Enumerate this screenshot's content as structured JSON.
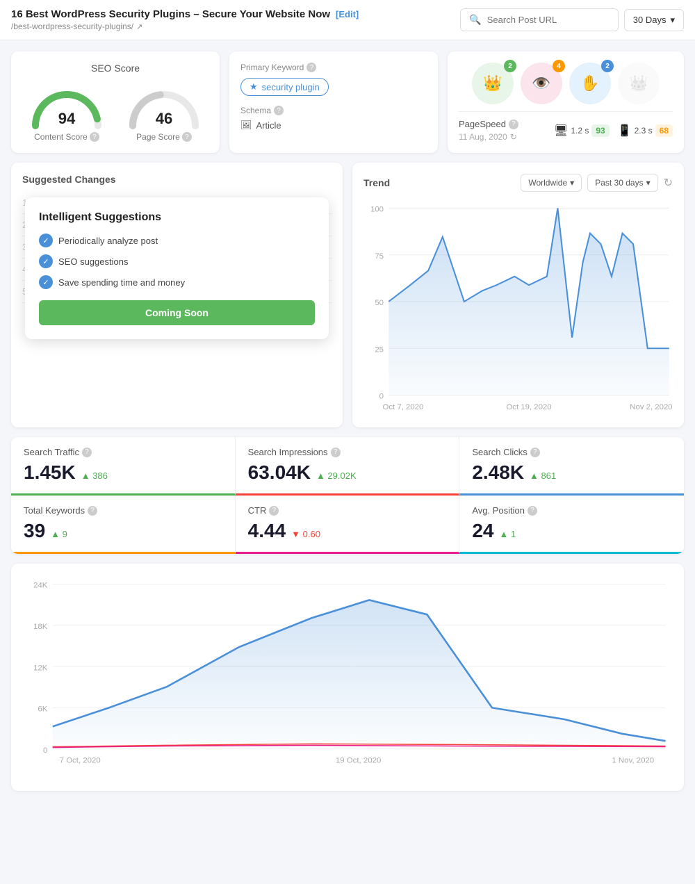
{
  "header": {
    "title": "16 Best WordPress Security Plugins – Secure Your Website Now",
    "edit_label": "[Edit]",
    "url": "/best-wordpress-security-plugins/",
    "search_placeholder": "Search Post URL",
    "days_label": "30 Days"
  },
  "seo_score": {
    "title": "SEO Score",
    "content_score": 94,
    "content_label": "Content Score",
    "page_score": 46,
    "page_label": "Page Score"
  },
  "primary_keyword": {
    "label": "Primary Keyword",
    "keyword": "security plugin",
    "schema_label": "Schema",
    "schema_value": "Article"
  },
  "badges": {
    "items": [
      {
        "emoji": "👑",
        "bg": "#e8f5e9",
        "count": 2,
        "count_color": "green"
      },
      {
        "emoji": "👁️",
        "bg": "#fce4ec",
        "count": 4,
        "count_color": "orange"
      },
      {
        "emoji": "🤚",
        "bg": "#e3f2fd",
        "count": 2,
        "count_color": "blue"
      },
      {
        "emoji": "👑",
        "bg": "#f5f5f5",
        "disabled": true
      }
    ]
  },
  "pagespeed": {
    "label": "PageSpeed",
    "date": "11 Aug, 2020",
    "desktop": {
      "time": "1.2 s",
      "score": 93
    },
    "mobile": {
      "time": "2.3 s",
      "score": 68
    }
  },
  "trend": {
    "title": "Trend",
    "location": "Worldwide",
    "period": "Past 30 days",
    "y_labels": [
      "100",
      "75",
      "50",
      "25",
      "0"
    ],
    "x_labels": [
      "Oct 7, 2020",
      "Oct 19, 2020",
      "Nov 2, 2020"
    ]
  },
  "suggested_changes": {
    "title": "Suggested Changes",
    "overlay": {
      "title": "Intelligent Suggestions",
      "items": [
        "Periodically analyze post",
        "SEO suggestions",
        "Save spending time and money"
      ],
      "button_label": "Coming Soon"
    }
  },
  "metrics": [
    {
      "label": "Search Traffic",
      "value": "1.45K",
      "change": "▲ 386",
      "direction": "up",
      "border": "green"
    },
    {
      "label": "Search Impressions",
      "value": "63.04K",
      "change": "▲ 29.02K",
      "direction": "up",
      "border": "red"
    },
    {
      "label": "Search Clicks",
      "value": "2.48K",
      "change": "▲ 861",
      "direction": "up",
      "border": "blue"
    },
    {
      "label": "Total Keywords",
      "value": "39",
      "change": "▲ 9",
      "direction": "up",
      "border": "orange"
    },
    {
      "label": "CTR",
      "value": "4.44",
      "change": "▼ 0.60",
      "direction": "down",
      "border": "pink"
    },
    {
      "label": "Avg. Position",
      "value": "24",
      "change": "▲ 1",
      "direction": "up",
      "border": "teal"
    }
  ],
  "bottom_chart": {
    "y_labels": [
      "24K",
      "18K",
      "12K",
      "6K",
      "0"
    ],
    "x_labels": [
      "7 Oct, 2020",
      "19 Oct, 2020",
      "1 Nov, 2020"
    ]
  }
}
